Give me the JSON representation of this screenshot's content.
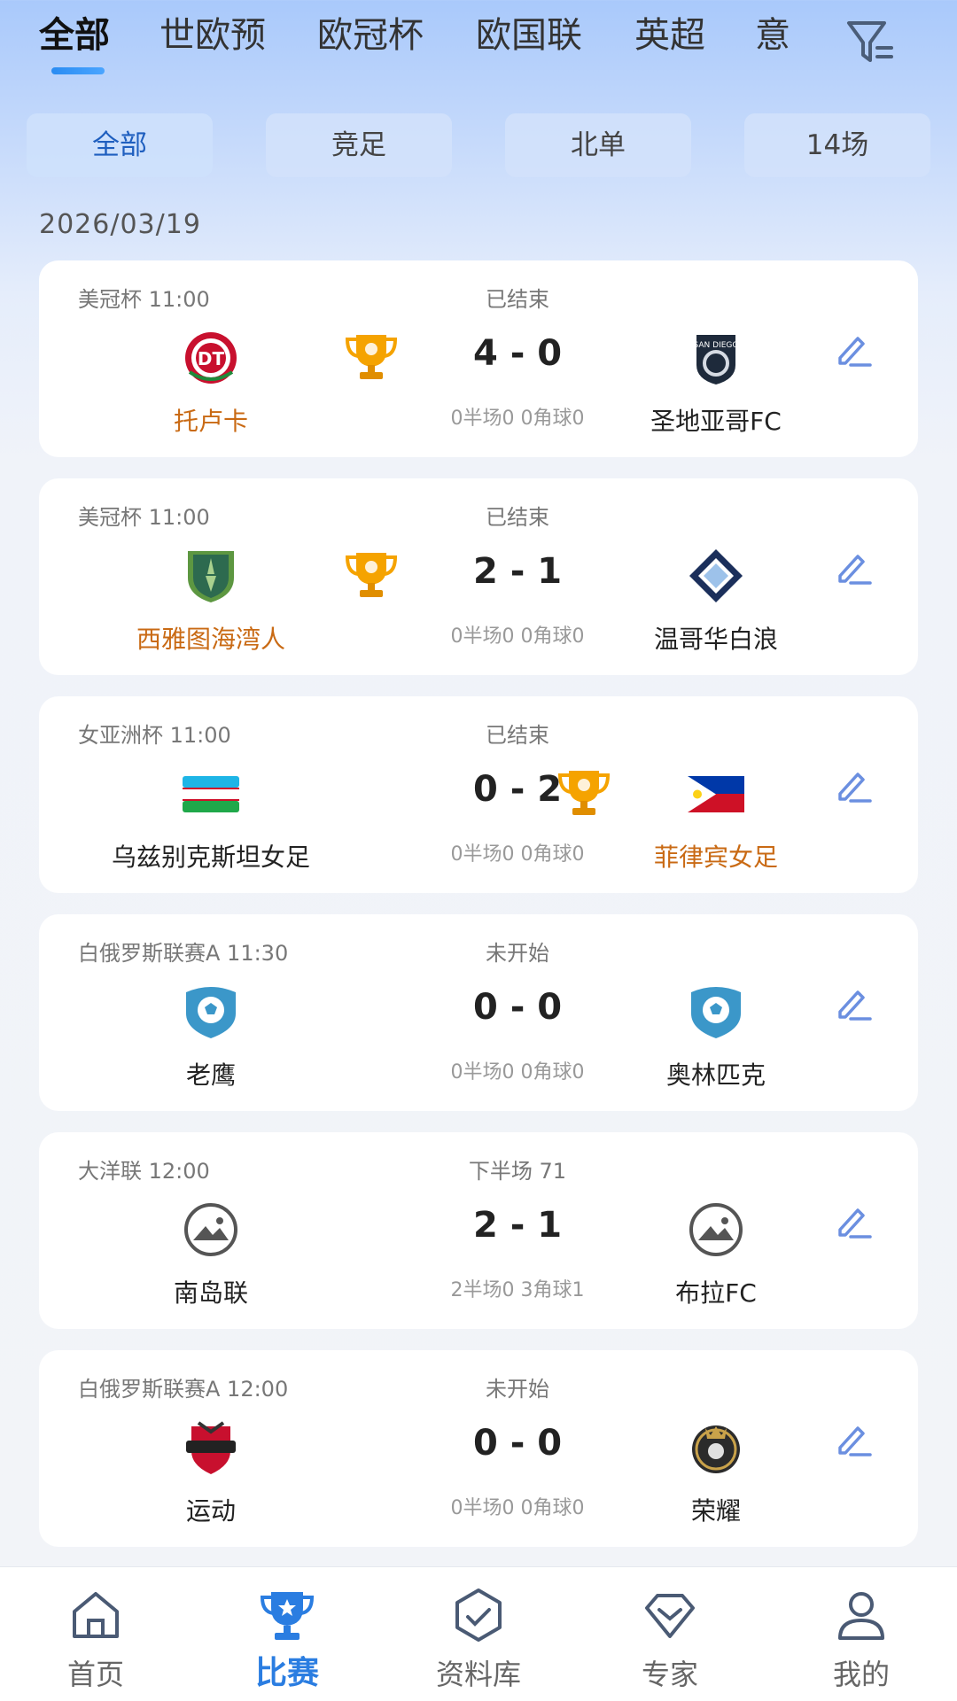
{
  "league_tabs": [
    "全部",
    "世欧预",
    "欧冠杯",
    "欧国联",
    "英超",
    "意"
  ],
  "type_chips": [
    "全部",
    "竞足",
    "北单",
    "14场"
  ],
  "date": "2026/03/19",
  "matches": [
    {
      "league_time": "美冠杯 11:00",
      "status": "已结束",
      "home": "托卢卡",
      "away": "圣地亚哥FC",
      "score": "4 - 0",
      "stats": "0半场0 0角球0",
      "winner": "home",
      "home_logo": "toluca-crest-icon",
      "away_logo": "san-diego-crest-icon"
    },
    {
      "league_time": "美冠杯 11:00",
      "status": "已结束",
      "home": "西雅图海湾人",
      "away": "温哥华白浪",
      "score": "2 - 1",
      "stats": "0半场0 0角球0",
      "winner": "home",
      "home_logo": "seattle-crest-icon",
      "away_logo": "vancouver-crest-icon"
    },
    {
      "league_time": "女亚洲杯 11:00",
      "status": "已结束",
      "home": "乌兹别克斯坦女足",
      "away": "菲律宾女足",
      "score": "0 - 2",
      "stats": "0半场0 0角球0",
      "winner": "away",
      "home_logo": "uzbekistan-flag-icon",
      "away_logo": "philippines-flag-icon"
    },
    {
      "league_time": "白俄罗斯联赛A 11:30",
      "status": "未开始",
      "home": "老鹰",
      "away": "奥林匹克",
      "score": "0 - 0",
      "stats": "0半场0 0角球0",
      "winner": "none",
      "home_logo": "football-shield-icon",
      "away_logo": "football-shield-icon"
    },
    {
      "league_time": "大洋联 12:00",
      "status": "下半场 71",
      "home": "南岛联",
      "away": "布拉FC",
      "score": "2 - 1",
      "stats": "2半场0 3角球1",
      "winner": "none",
      "home_logo": "image-placeholder-icon",
      "away_logo": "image-placeholder-icon"
    },
    {
      "league_time": "白俄罗斯联赛A 12:00",
      "status": "未开始",
      "home": "运动",
      "away": "荣耀",
      "score": "0 - 0",
      "stats": "0半场0 0角球0",
      "winner": "none",
      "home_logo": "athletic-crest-icon",
      "away_logo": "glory-crest-icon"
    }
  ],
  "bottom_nav": [
    "首页",
    "比赛",
    "资料库",
    "专家",
    "我的"
  ],
  "colors": {
    "accent": "#2a7de1",
    "winner": "#c96a14",
    "trophy": "#f5a300",
    "edit": "#6b8fe0"
  }
}
